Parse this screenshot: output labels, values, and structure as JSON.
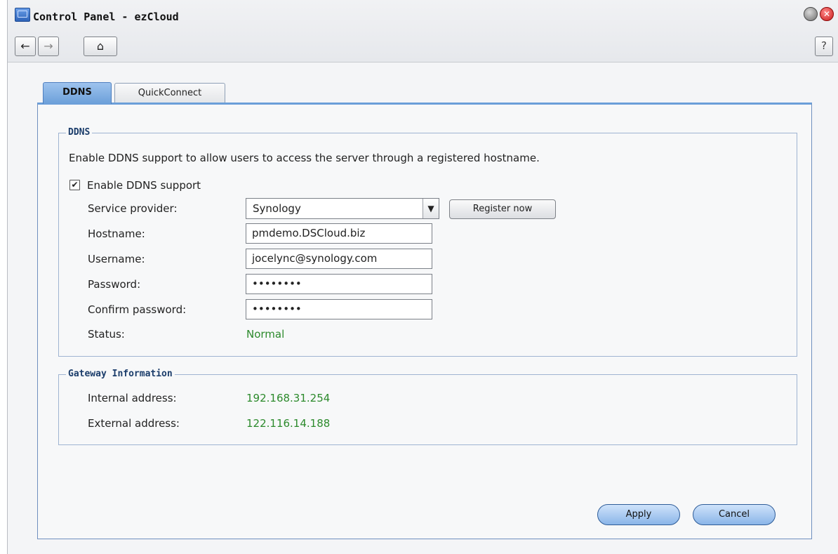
{
  "window": {
    "title": "Control Panel - ezCloud",
    "close_glyph": "✕",
    "nav": {
      "back": "←",
      "forward": "→",
      "home": "⌂",
      "help": "?"
    }
  },
  "tabs": [
    {
      "label": "DDNS",
      "active": true
    },
    {
      "label": "QuickConnect",
      "active": false
    }
  ],
  "ddns": {
    "legend": "DDNS",
    "description": "Enable DDNS support to allow users to access the server through a registered hostname.",
    "enable_label": "Enable DDNS support",
    "enable_checked": true,
    "check_glyph": "✔",
    "fields": {
      "service_provider_label": "Service provider:",
      "service_provider_value": "Synology",
      "dropdown_glyph": "▼",
      "register_label": "Register now",
      "hostname_label": "Hostname:",
      "hostname_value": "pmdemo.DSCloud.biz",
      "username_label": "Username:",
      "username_value": "jocelync@synology.com",
      "password_label": "Password:",
      "password_value": "••••••••",
      "confirm_label": "Confirm password:",
      "confirm_value": "••••••••",
      "status_label": "Status:",
      "status_value": "Normal"
    }
  },
  "gateway": {
    "legend": "Gateway Information",
    "internal_label": "Internal address:",
    "internal_value": "192.168.31.254",
    "external_label": "External address:",
    "external_value": "122.116.14.188"
  },
  "actions": {
    "apply": "Apply",
    "cancel": "Cancel"
  },
  "colors": {
    "accent": "#6b9fd9",
    "status_green": "#2c8a2c",
    "legend_blue": "#1b3d6b"
  },
  "icons": {
    "app": "control-panel-icon",
    "minimize": "minimize-icon",
    "close": "close-icon"
  }
}
